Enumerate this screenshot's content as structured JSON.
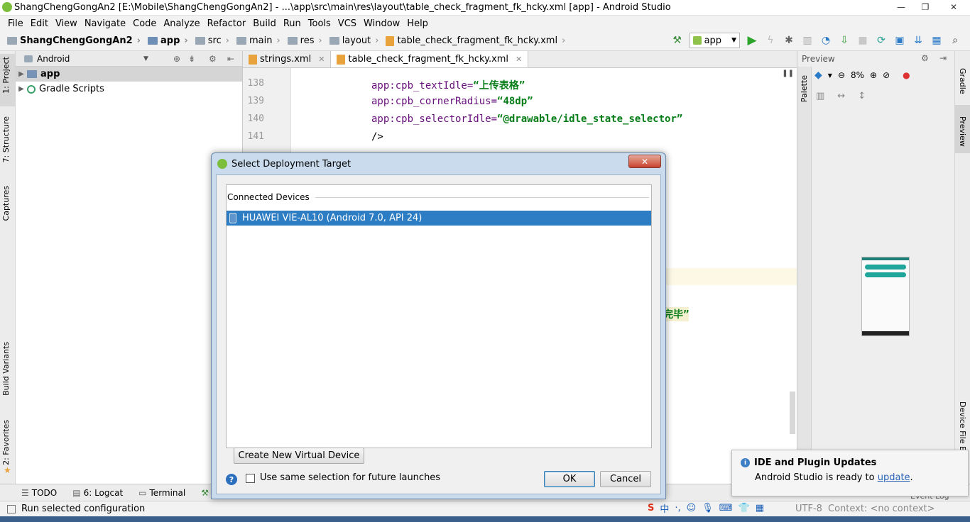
{
  "window": {
    "title": "ShangChengGongAn2 [E:\\Mobile\\ShangChengGongAn2] - ...\\app\\src\\main\\res\\layout\\table_check_fragment_fk_hcky.xml [app] - Android Studio",
    "minimize": "—",
    "maximize": "❐",
    "close": "✕"
  },
  "menu": [
    "File",
    "Edit",
    "View",
    "Navigate",
    "Code",
    "Analyze",
    "Refactor",
    "Build",
    "Run",
    "Tools",
    "VCS",
    "Window",
    "Help"
  ],
  "breadcrumb": [
    "ShangChengGongAn2",
    "app",
    "src",
    "main",
    "res",
    "layout",
    "table_check_fragment_fk_hcky.xml"
  ],
  "toolbar": {
    "run_config": "app"
  },
  "left_strip": {
    "project": "1: Project",
    "structure": "7: Structure",
    "captures": "Captures",
    "build_variants": "Build Variants",
    "favorites": "2: Favorites"
  },
  "project_panel": {
    "view_mode": "Android",
    "items": [
      {
        "label": "app",
        "selected": true
      },
      {
        "label": "Gradle Scripts",
        "selected": false
      }
    ]
  },
  "editor": {
    "tabs": [
      {
        "label": "strings.xml",
        "active": false
      },
      {
        "label": "table_check_fragment_fk_hcky.xml",
        "active": true
      }
    ],
    "lines": [
      {
        "num": "138",
        "attr": "app:cpb_textIdle=",
        "val": "“上传表格”"
      },
      {
        "num": "139",
        "attr": "app:cpb_cornerRadius=",
        "val": "“48dp”"
      },
      {
        "num": "140",
        "attr": "app:cpb_selectorIdle=",
        "val": "“@drawable/idle_state_selector”"
      },
      {
        "num": "141",
        "attr": "",
        "val": "/>"
      }
    ],
    "fragment_text": "完毕”"
  },
  "preview": {
    "title": "Preview",
    "zoom": "8%",
    "palette": "Palette"
  },
  "right_strip": {
    "gradle": "Gradle",
    "preview": "Preview",
    "device_file": "Device File E"
  },
  "bottom_tabs": [
    "TODO",
    "6: Logcat",
    "Terminal",
    "Bu"
  ],
  "status": {
    "text": "Run selected configuration",
    "encoding": "UTF-8",
    "context": "Context: <no context>",
    "event_log": "Event Log"
  },
  "notification": {
    "title": "IDE and Plugin Updates",
    "body": "Android Studio is ready to ",
    "link": "update",
    "tail": "."
  },
  "dialog": {
    "title": "Select Deployment Target",
    "group": "Connected Devices",
    "device": "HUAWEI VIE-AL10 (Android 7.0, API 24)",
    "create_button": "Create New Virtual Device",
    "checkbox_label": "Use same selection for future launches",
    "ok": "OK",
    "cancel": "Cancel",
    "help": "?"
  },
  "colors": {
    "selection": "#2d7dc4",
    "xml_attr": "#660e7a",
    "xml_value": "#067d17",
    "run_green": "#2aa52a"
  }
}
